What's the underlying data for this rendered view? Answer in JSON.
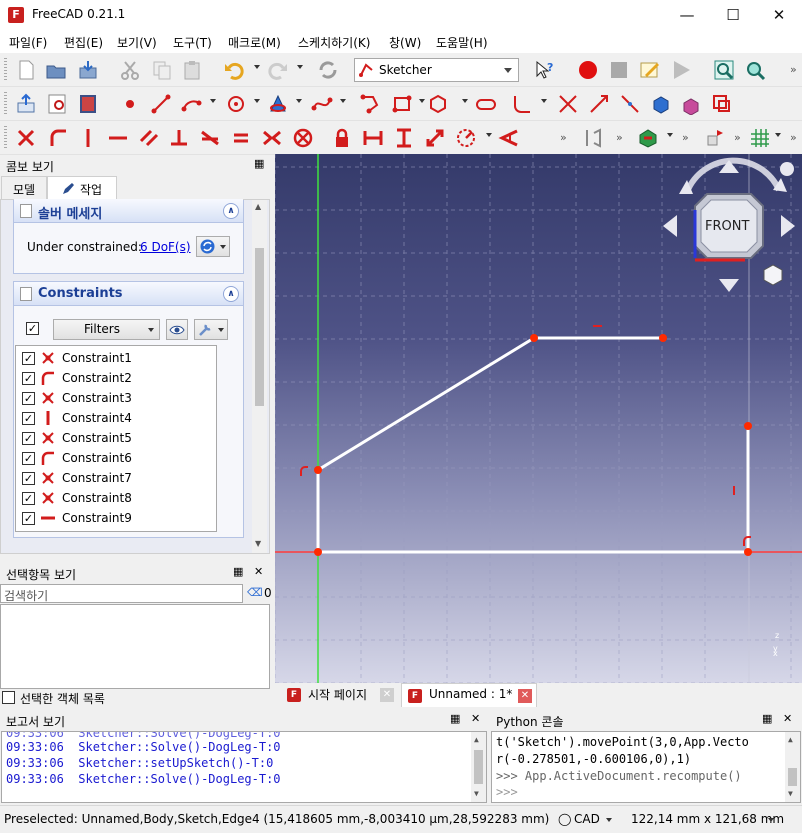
{
  "window": {
    "title": "FreeCAD 0.21.1",
    "logo": "F"
  },
  "menu": [
    "파일(F)",
    "편집(E)",
    "보기(V)",
    "도구(T)",
    "매크로(M)",
    "스케치하기(K)",
    "창(W)",
    "도움말(H)"
  ],
  "toolbar": {
    "workbench": "Sketcher",
    "more": "»"
  },
  "combo": {
    "title": "콤보 보기",
    "tabs": [
      "모델",
      "작업"
    ],
    "solver": {
      "title": "솔버 메세지",
      "status_prefix": "Under constrained:",
      "dof_link": "6 DoF(s)"
    },
    "constraints": {
      "title": "Constraints",
      "filters_label": "Filters",
      "items": [
        {
          "label": "Constraint1",
          "icon": "coincident-icon"
        },
        {
          "label": "Constraint2",
          "icon": "tangent-icon"
        },
        {
          "label": "Constraint3",
          "icon": "coincident-icon"
        },
        {
          "label": "Constraint4",
          "icon": "vertical-icon"
        },
        {
          "label": "Constraint5",
          "icon": "coincident-icon"
        },
        {
          "label": "Constraint6",
          "icon": "tangent-icon"
        },
        {
          "label": "Constraint7",
          "icon": "coincident-icon"
        },
        {
          "label": "Constraint8",
          "icon": "coincident-icon"
        },
        {
          "label": "Constraint9",
          "icon": "horizontal-icon"
        }
      ]
    }
  },
  "selection": {
    "title": "선택항목 보기",
    "search_placeholder": "검색하기",
    "count": "0",
    "objects_list_label": "선택한 객체 목록"
  },
  "navcube": {
    "face": "FRONT"
  },
  "doc_tabs": [
    {
      "label": "시작 페이지"
    },
    {
      "label": "Unnamed : 1*"
    }
  ],
  "report": {
    "title": "보고서 보기",
    "lines": [
      "09:33:06  Sketcher::Solve()-DogLeg-T:0",
      "09:33:06  Sketcher::setUpSketch()-T:0",
      "09:33:06  Sketcher::Solve()-DogLeg-T:0"
    ]
  },
  "python": {
    "title": "Python 콘솔",
    "lines": [
      "t('Sketch').movePoint(3,0,App.Vecto",
      "r(-0.278501,-0.600106,0),1)",
      ">>> App.ActiveDocument.recompute()",
      ">>>"
    ]
  },
  "status": {
    "preselected": "Preselected: Unnamed,Body,Sketch,Edge4 (15,418605 mm,-8,003410 µm,28,592283 mm)",
    "nav_style": "CAD",
    "dimensions": "122,14 mm x 121,68 mm"
  },
  "colors": {
    "sketch_line": "#ffffff",
    "vertex": "#ff2a00",
    "axis_x": "#ff3b3b",
    "axis_y": "#52e052",
    "accent": "#1c3f95"
  }
}
